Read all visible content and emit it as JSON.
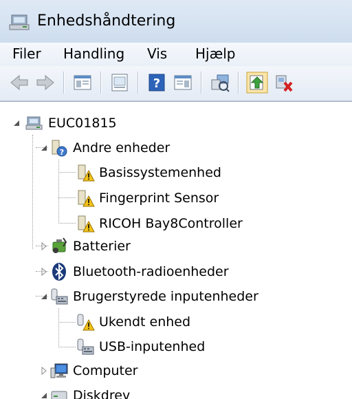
{
  "window": {
    "title": "Enhedshåndtering",
    "icon": "device-manager-icon"
  },
  "menu": {
    "file": "Filer",
    "action": "Handling",
    "view": "Vis",
    "help": "Hjælp"
  },
  "toolbar": {
    "buttons": [
      "back-arrow-icon",
      "forward-arrow-icon",
      "show-hide-console-tree-icon",
      "properties-icon",
      "help-icon",
      "show-action-pane-icon",
      "scan-hardware-icon",
      "update-driver-icon",
      "uninstall-device-icon"
    ]
  },
  "tree": {
    "root": {
      "label": "EUC01815",
      "icon": "computer-tree-icon",
      "expanded": true
    },
    "other_devices": {
      "label": "Andre enheder",
      "icon": "unknown-device-icon",
      "expanded": true
    },
    "other_children": [
      {
        "label": "Basissystemenhed",
        "icon": "warning-device-icon"
      },
      {
        "label": "Fingerprint Sensor",
        "icon": "warning-device-icon"
      },
      {
        "label": "RICOH Bay8Controller",
        "icon": "warning-device-icon"
      }
    ],
    "batteries": {
      "label": "Batterier",
      "icon": "battery-icon",
      "expanded": false
    },
    "bluetooth": {
      "label": "Bluetooth-radioenheder",
      "icon": "bluetooth-icon",
      "expanded": false
    },
    "hid": {
      "label": "Brugerstyrede inputenheder",
      "icon": "hid-icon",
      "expanded": true
    },
    "hid_children": [
      {
        "label": "Ukendt enhed",
        "icon": "warning-hid-icon"
      },
      {
        "label": "USB-inputenhed",
        "icon": "hid-icon"
      }
    ],
    "computer": {
      "label": "Computer",
      "icon": "monitor-icon",
      "expanded": false
    },
    "disk": {
      "label": "Diskdrev",
      "icon": "disk-icon",
      "expanded": true
    }
  }
}
